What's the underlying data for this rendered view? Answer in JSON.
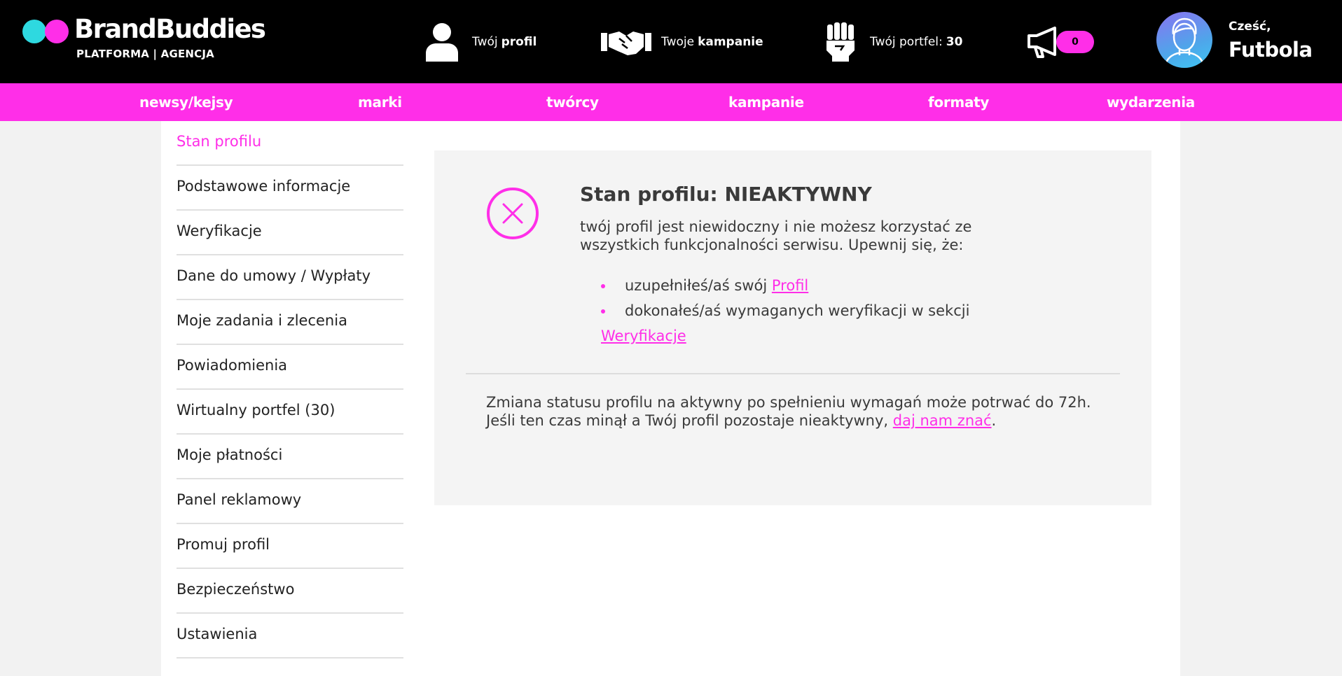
{
  "header": {
    "brand": "BrandBuddies",
    "subtitle": "PLATFORMA | AGENCJA",
    "profile": {
      "prefix": "Twój",
      "bold": "profil"
    },
    "campaigns": {
      "prefix": "Twoje",
      "bold": "kampanie"
    },
    "wallet": {
      "prefix": "Twój portfel:",
      "bold": "30"
    },
    "notifications": {
      "count": "0"
    },
    "greeting": "Cześć,",
    "user_name": "Futbola"
  },
  "nav": {
    "items": [
      "newsy/kejsy",
      "marki",
      "twórcy",
      "kampanie",
      "formaty",
      "wydarzenia"
    ]
  },
  "sidebar": {
    "items": [
      "Stan profilu",
      "Podstawowe informacje",
      "Weryfikacje",
      "Dane do umowy / Wypłaty",
      "Moje zadania i zlecenia",
      "Powiadomienia",
      "Wirtualny portfel (30)",
      "Moje płatności",
      "Panel reklamowy",
      "Promuj profil",
      "Bezpieczeństwo",
      "Ustawienia"
    ],
    "active_index": 0
  },
  "status": {
    "title": "Stan profilu: NIEAKTYWNY",
    "description": "twój profil jest niewidoczny i nie możesz korzystać ze wszystkich funkcjonalności serwisu. Upewnij się, że:",
    "bullet1_text": "uzupełniłeś/aś swój",
    "bullet1_link": "Profil",
    "bullet2_text": "dokonałeś/aś wymaganych weryfikacji w sekcji",
    "bullet2_link": "Weryfikacje",
    "note_text": "Zmiana statusu profilu na aktywny po spełnieniu wymagań może potrwać do 72h. Jeśli ten czas minął a Twój profil pozostaje nieaktywny,",
    "note_link": "daj nam znać",
    "note_end": "."
  },
  "colors": {
    "accent": "#ff2ee8",
    "header_bg": "#000000",
    "logo_cyan": "#2ed9e0"
  }
}
